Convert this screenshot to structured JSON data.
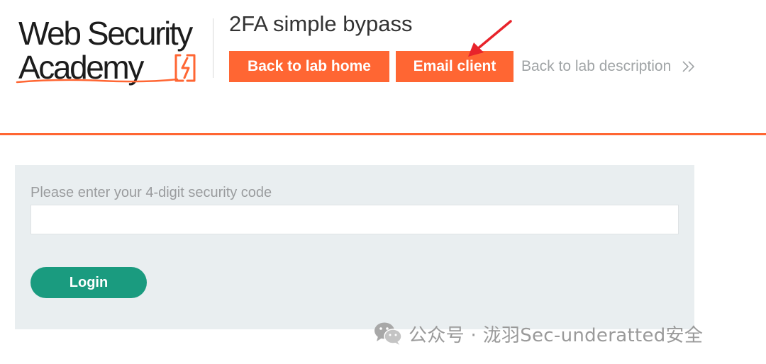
{
  "header": {
    "logo_line1": "Web Security",
    "logo_line2": "Academy",
    "lab_title": "2FA simple bypass",
    "back_to_lab_home": "Back to lab home",
    "email_client": "Email client",
    "back_to_lab_description": "Back to lab description"
  },
  "form": {
    "label": "Please enter your 4-digit security code",
    "input_value": "",
    "login_label": "Login"
  },
  "watermark": {
    "text": "公众号 · 泷羽Sec-underatted安全"
  },
  "colors": {
    "accent_orange": "#ff6633",
    "login_green": "#1a9b7f",
    "panel_bg": "#e9eef0",
    "annotation_red": "#e8232b"
  },
  "icons": {
    "logo_mark": "lightning-bolt-icon",
    "back_link": "double-chevron-right-icon",
    "annotation": "red-arrow-icon",
    "watermark": "wechat-icon"
  }
}
